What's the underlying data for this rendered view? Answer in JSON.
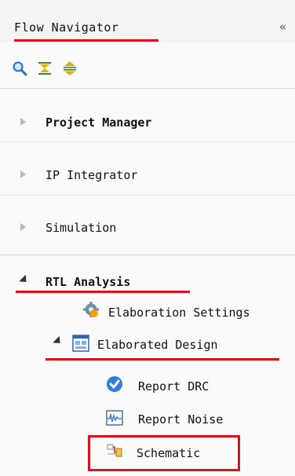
{
  "panel": {
    "title": "Flow Navigator",
    "collapse_glyph": "«"
  },
  "toolbar": {
    "buttons": [
      {
        "icon": "search-icon"
      },
      {
        "icon": "collapse-all-icon"
      },
      {
        "icon": "expand-all-icon"
      }
    ]
  },
  "sections": [
    {
      "label": "Project Manager",
      "expanded": false
    },
    {
      "label": "IP Integrator",
      "expanded": false
    },
    {
      "label": "Simulation",
      "expanded": false
    },
    {
      "label": "RTL Analysis",
      "expanded": true
    }
  ],
  "rtl_items": {
    "elab_settings": "Elaboration Settings",
    "elab_design": "Elaborated Design",
    "report_drc": "Report DRC",
    "report_noise": "Report Noise",
    "schematic": "Schematic"
  },
  "colors": {
    "highlight": "#d9121d"
  }
}
